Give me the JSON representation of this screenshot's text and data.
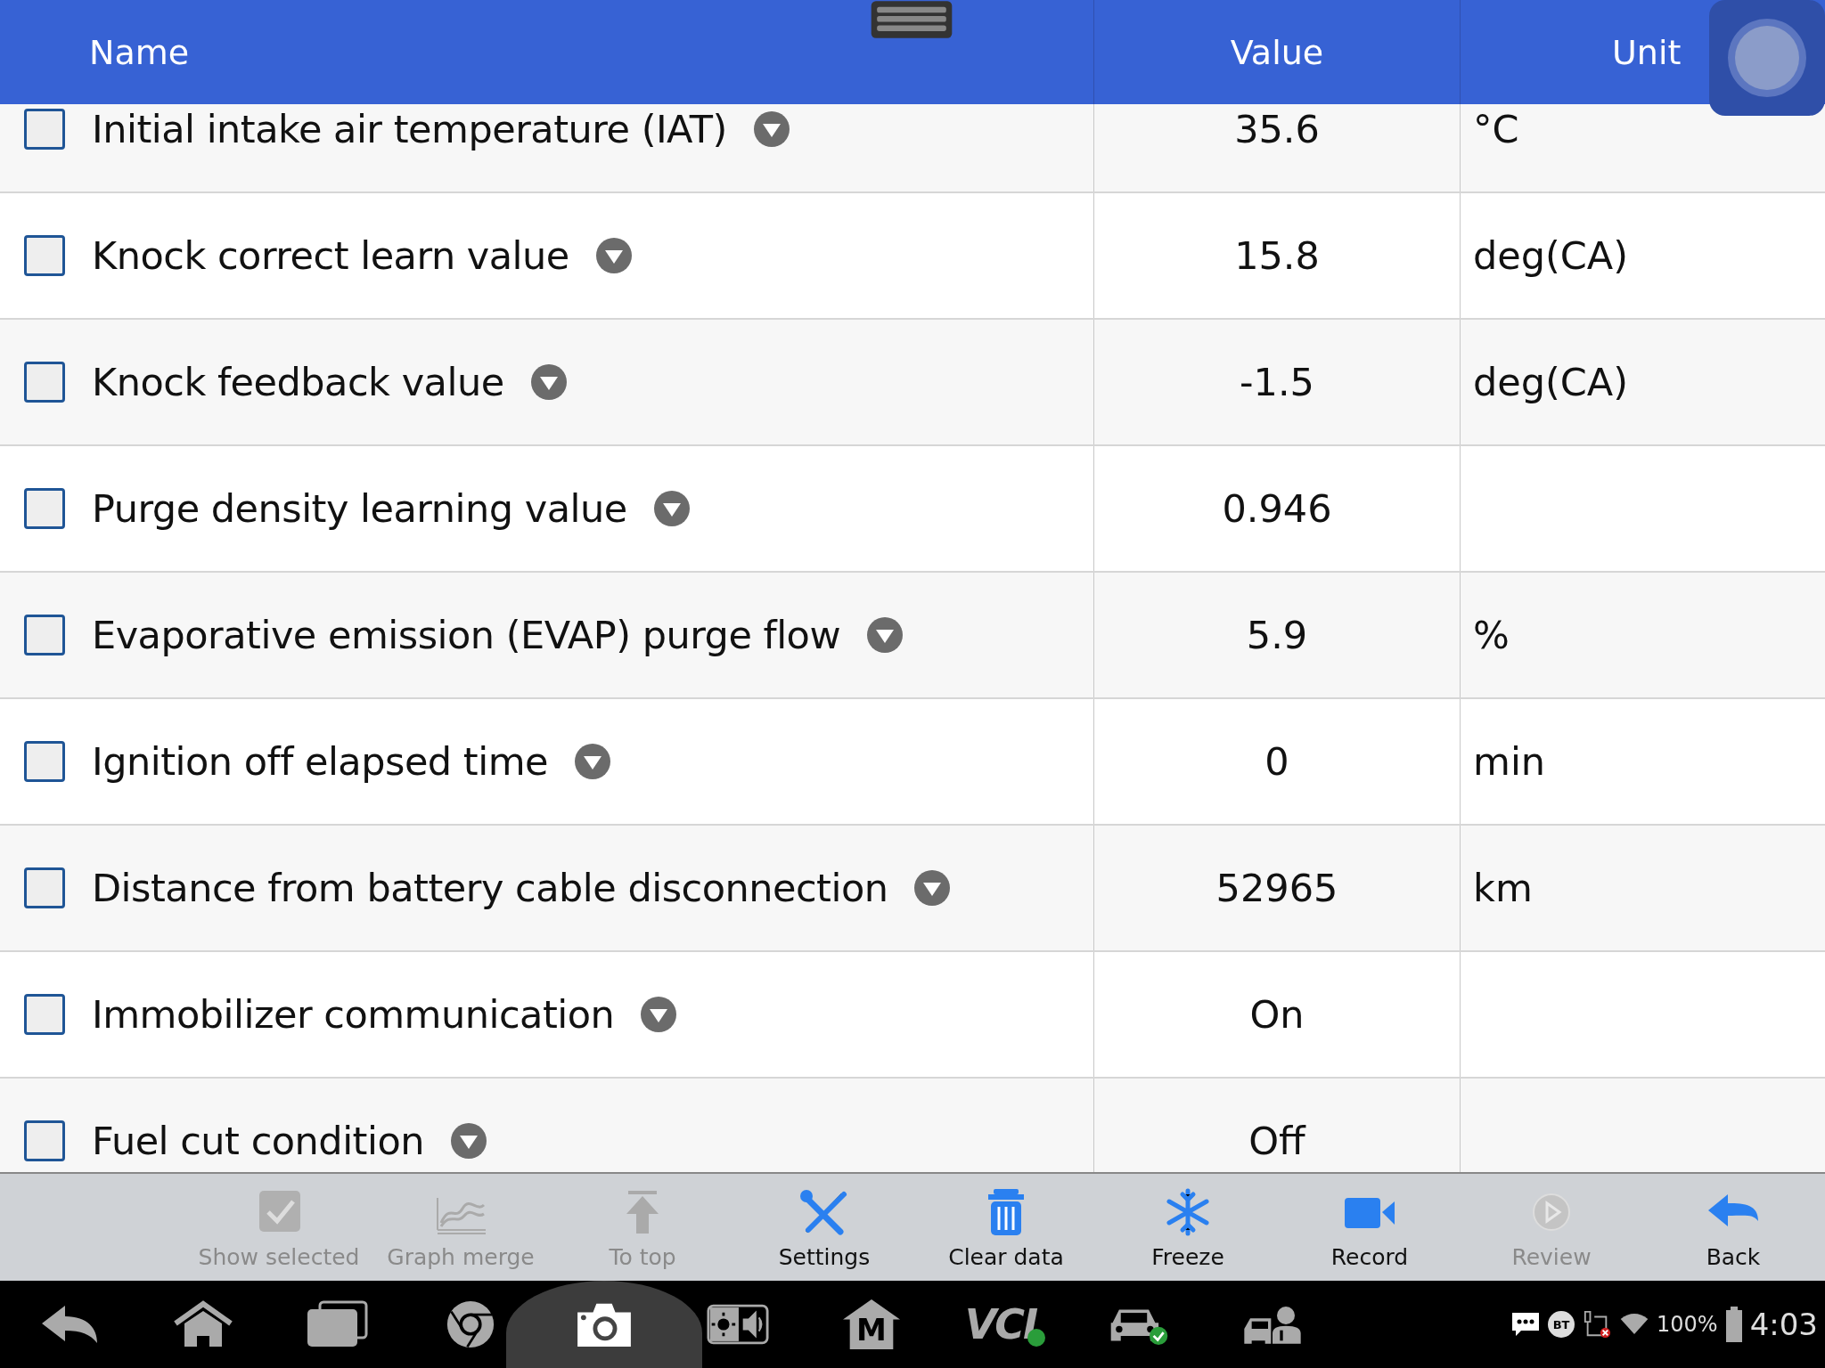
{
  "header": {
    "columns": [
      "Name",
      "Value",
      "Unit"
    ]
  },
  "rows": [
    {
      "name": "Initial intake air temperature (IAT)",
      "value": "35.6",
      "unit": "°C",
      "checked": false
    },
    {
      "name": "Knock correct learn value",
      "value": "15.8",
      "unit": "deg(CA)",
      "checked": false
    },
    {
      "name": "Knock feedback value",
      "value": "-1.5",
      "unit": "deg(CA)",
      "checked": false
    },
    {
      "name": "Purge density learning value",
      "value": "0.946",
      "checked": false
    },
    {
      "name": "Evaporative emission (EVAP) purge flow",
      "value": "5.9",
      "unit": "%",
      "checked": false
    },
    {
      "name": "Ignition off elapsed time",
      "value": "0",
      "unit": "min",
      "checked": false
    },
    {
      "name": "Distance from battery cable disconnection",
      "value": "52965",
      "unit": "km",
      "checked": false
    },
    {
      "name": "Immobilizer communication",
      "value": "On",
      "checked": false
    },
    {
      "name": "Fuel cut condition",
      "value": "Off",
      "checked": false
    }
  ],
  "toolbar": [
    {
      "kind": "check",
      "label": "Show selected",
      "disabled": true
    },
    {
      "kind": "graph",
      "label": "Graph merge",
      "disabled": true
    },
    {
      "kind": "top",
      "label": "To top",
      "disabled": true
    },
    {
      "kind": "tools",
      "label": "Settings",
      "disabled": false
    },
    {
      "kind": "trash",
      "label": "Clear data",
      "disabled": false
    },
    {
      "kind": "snow",
      "label": "Freeze",
      "disabled": false
    },
    {
      "kind": "video",
      "label": "Record",
      "disabled": false
    },
    {
      "kind": "play",
      "label": "Review",
      "disabled": true
    },
    {
      "kind": "back",
      "label": "Back",
      "disabled": false
    }
  ],
  "nav": [
    {
      "kind": "back",
      "selected": false
    },
    {
      "kind": "home",
      "selected": false
    },
    {
      "kind": "recents",
      "selected": false
    },
    {
      "kind": "browser",
      "selected": false
    },
    {
      "kind": "camera",
      "selected": true
    },
    {
      "kind": "display",
      "selected": false
    },
    {
      "kind": "maxi",
      "label": "M",
      "selected": false
    },
    {
      "kind": "vci",
      "label": "VCI",
      "selected": false
    },
    {
      "kind": "car",
      "selected": false
    },
    {
      "kind": "service",
      "selected": false
    }
  ],
  "status": {
    "bt": "BT",
    "battery": "100%",
    "time": "4:03"
  }
}
